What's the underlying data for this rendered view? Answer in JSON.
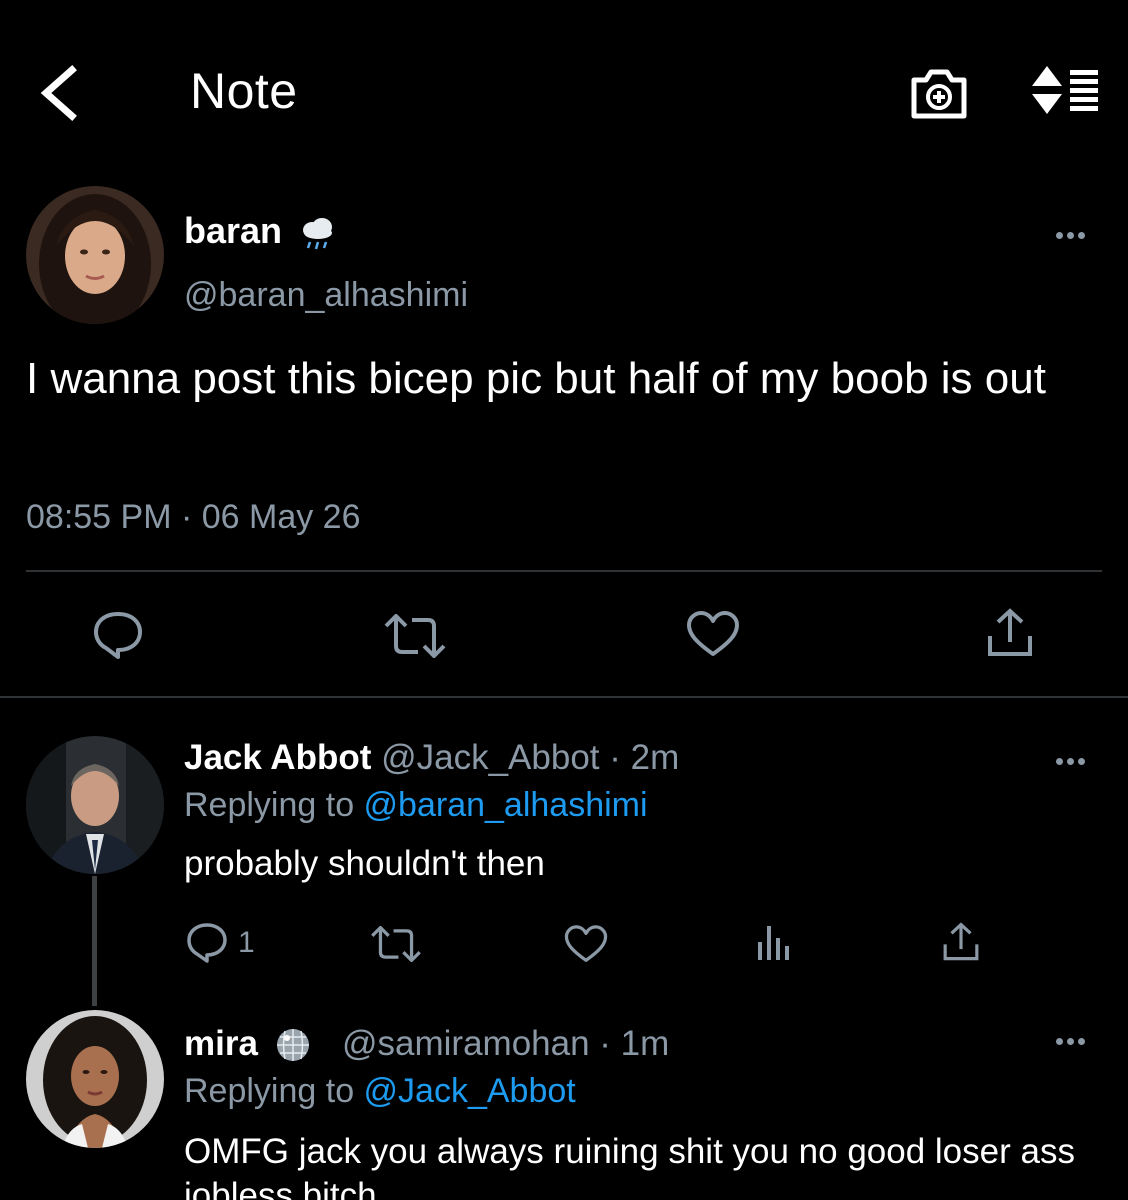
{
  "header": {
    "title": "Note",
    "back_icon": "chevron-left-icon",
    "camera_icon": "camera-add-icon",
    "sort_icon": "sort-list-icon"
  },
  "post": {
    "display_name": "baran",
    "name_emoji": "cloud-rain-emoji",
    "handle": "@baran_alhashimi",
    "text": "I wanna post this bicep pic but half of my boob is out",
    "timestamp": "08:55 PM · 06 May 26",
    "actions": [
      "reply-icon",
      "retweet-icon",
      "like-icon",
      "share-icon"
    ]
  },
  "replies": [
    {
      "display_name": "Jack Abbot",
      "handle_meta": "@Jack_Abbot · 2m",
      "replying_prefix": "Replying to ",
      "replying_to": "@baran_alhashimi",
      "text": "probably shouldn't then",
      "reply_count": "1",
      "actions": [
        "reply-icon",
        "retweet-icon",
        "like-icon",
        "analytics-icon",
        "share-icon"
      ]
    },
    {
      "display_name": "mira",
      "name_emoji": "disco-ball-emoji",
      "handle_meta": "@samiramohan · 1m",
      "replying_prefix": "Replying to ",
      "replying_to": "@Jack_Abbot",
      "text": "OMFG jack you always ruining shit you no good loser ass jobless bitch"
    }
  ],
  "colors": {
    "background": "#000000",
    "text_primary": "#ffffff",
    "text_secondary": "#8b98a5",
    "accent": "#1d9bf0",
    "divider": "#2f3336"
  }
}
